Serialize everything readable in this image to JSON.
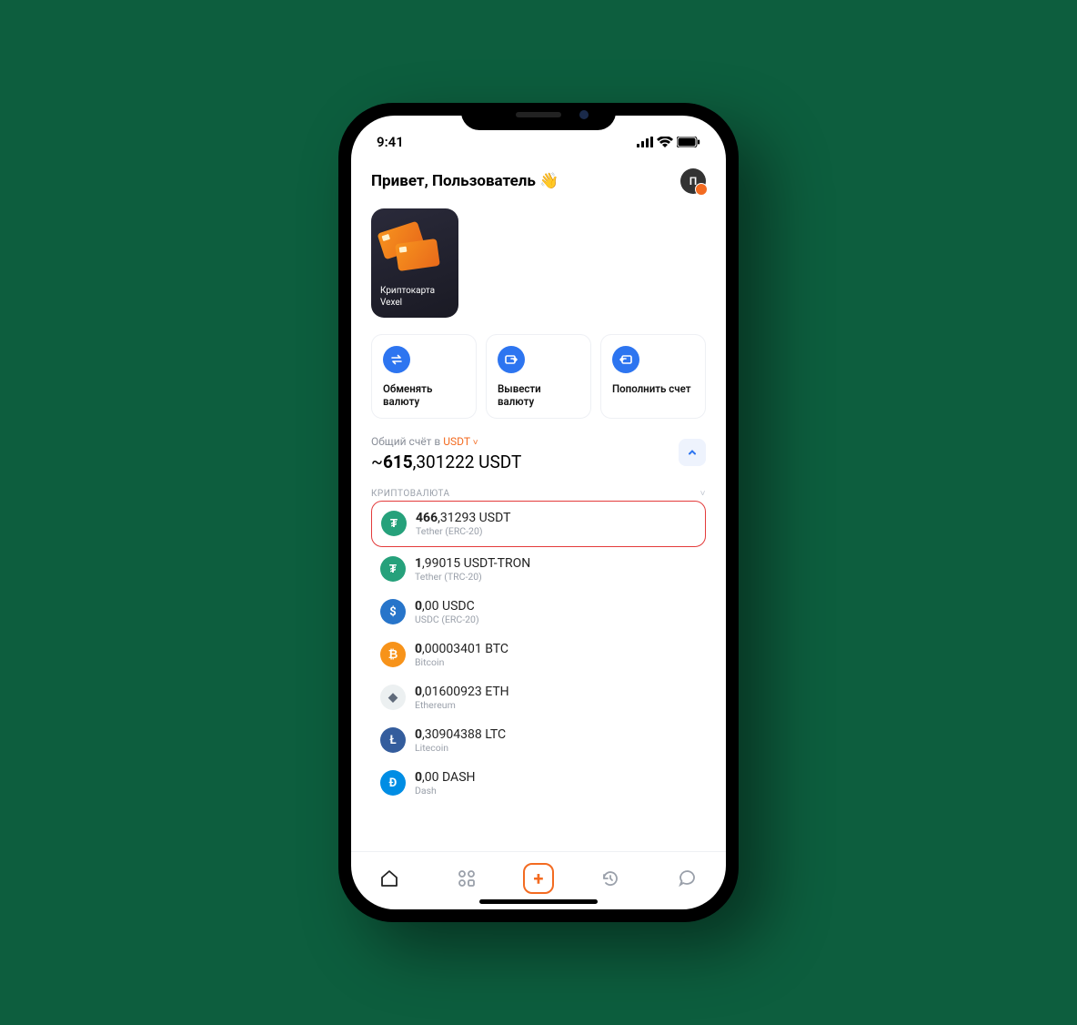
{
  "status": {
    "time": "9:41"
  },
  "header": {
    "greeting": "Привет, Пользователь 👋",
    "avatar_initial": "П"
  },
  "card_tile": {
    "line1": "Криптокарта",
    "line2": "Vexel"
  },
  "actions": [
    {
      "label": "Обменять валюту"
    },
    {
      "label": "Вывести валюту"
    },
    {
      "label": "Пополнить счет"
    }
  ],
  "total": {
    "label_prefix": "Общий счёт в ",
    "currency": "USDT",
    "tilde": "~",
    "whole": "615",
    "frac": ",301222 USDT"
  },
  "section": {
    "title": "КРИПТОВАЛЮТА"
  },
  "coins": [
    {
      "whole": "466",
      "frac": ",31293 USDT",
      "sub": "Tether (ERC-20)",
      "bg": "#26a17b",
      "sym": "₮",
      "hl": true
    },
    {
      "whole": "1",
      "frac": ",99015 USDT-TRON",
      "sub": "Tether (TRC-20)",
      "bg": "#26a17b",
      "sym": "₮",
      "hl": false
    },
    {
      "whole": "0",
      "frac": ",00 USDC",
      "sub": "USDC (ERC-20)",
      "bg": "#2775ca",
      "sym": "$",
      "hl": false
    },
    {
      "whole": "0",
      "frac": ",00003401 BTC",
      "sub": "Bitcoin",
      "bg": "#f7931a",
      "sym": "₿",
      "hl": false
    },
    {
      "whole": "0",
      "frac": ",01600923 ETH",
      "sub": "Ethereum",
      "bg": "#ecf0f1",
      "sym": "◆",
      "hl": false,
      "fg": "#5f6a7a"
    },
    {
      "whole": "0",
      "frac": ",30904388 LTC",
      "sub": "Litecoin",
      "bg": "#345d9d",
      "sym": "Ł",
      "hl": false
    },
    {
      "whole": "0",
      "frac": ",00 DASH",
      "sub": "Dash",
      "bg": "#008de4",
      "sym": "Đ",
      "hl": false
    }
  ]
}
